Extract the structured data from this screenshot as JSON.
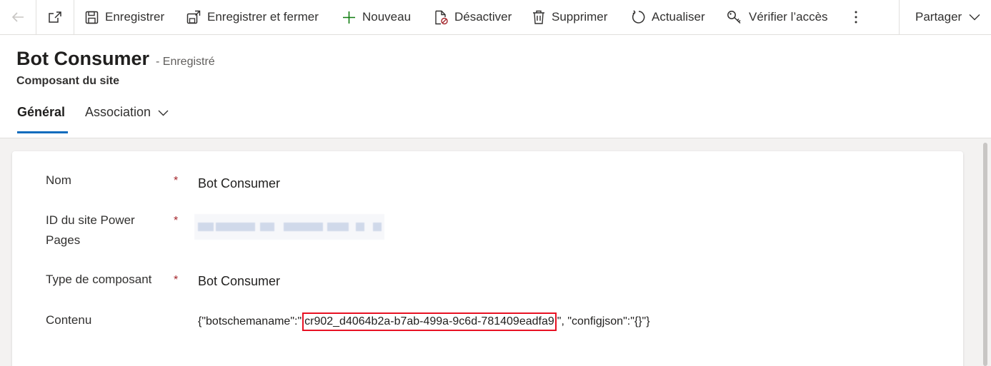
{
  "toolbar": {
    "save": "Enregistrer",
    "save_close": "Enregistrer et fermer",
    "new": "Nouveau",
    "deactivate": "Désactiver",
    "delete": "Supprimer",
    "refresh": "Actualiser",
    "check_access": "Vérifier l’accès",
    "share": "Partager"
  },
  "record": {
    "title": "Bot Consumer",
    "status": "- Enregistré",
    "entity": "Composant du site"
  },
  "tabs": {
    "general": "Général",
    "association": "Association"
  },
  "form": {
    "name_label": "Nom",
    "name_value": "Bot Consumer",
    "site_id_label": "ID du site Power Pages",
    "type_label": "Type de composant",
    "type_value": "Bot Consumer",
    "content_label": "Contenu",
    "content_prefix": "{\"botschemaname\":\"",
    "content_highlight": "cr902_d4064b2a-b7ab-499a-9c6d-781409eadfa9",
    "content_suffix": "\", \"configjson\":\"{}\"}",
    "required_mark": "*"
  },
  "icons": [
    "back-arrow-icon",
    "popout-icon",
    "save-icon",
    "save-close-icon",
    "plus-icon",
    "deactivate-icon",
    "trash-icon",
    "refresh-icon",
    "key-icon",
    "more-icon",
    "chevron-down-icon"
  ],
  "colors": {
    "accent": "#0f6cbd",
    "required": "#a4262c",
    "highlight": "#e81123",
    "new_icon": "#107c10"
  }
}
